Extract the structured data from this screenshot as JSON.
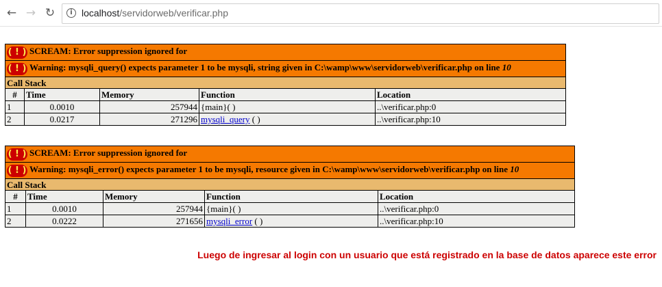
{
  "browser": {
    "back_icon": "arrow-left",
    "forward_icon": "arrow-right",
    "reload_icon": "reload",
    "info_icon": "info",
    "url_host": "localhost",
    "url_path": "/servidorweb/verificar.php"
  },
  "errors": [
    {
      "scream": "SCREAM: Error suppression ignored for",
      "warning_text": "Warning: mysqli_query() expects parameter 1 to be mysqli, string given in C:\\wamp\\www\\servidorweb\\verificar.php on line",
      "line": "10",
      "call_stack_title": "Call Stack",
      "columns": [
        "#",
        "Time",
        "Memory",
        "Function",
        "Location"
      ],
      "rows": [
        {
          "num": "1",
          "time": "0.0010",
          "memory": "257944",
          "func": "{main}",
          "func_suffix": "( )",
          "location": "..\\verificar.php:0"
        },
        {
          "num": "2",
          "time": "0.0217",
          "memory": "271296",
          "func": "mysqli_query",
          "func_suffix": "( )",
          "location": "..\\verificar.php:10"
        }
      ]
    },
    {
      "scream": "SCREAM: Error suppression ignored for",
      "warning_text": "Warning: mysqli_error() expects parameter 1 to be mysqli, resource given in C:\\wamp\\www\\servidorweb\\verificar.php on line",
      "line": "10",
      "call_stack_title": "Call Stack",
      "columns": [
        "#",
        "Time",
        "Memory",
        "Function",
        "Location"
      ],
      "rows": [
        {
          "num": "1",
          "time": "0.0010",
          "memory": "257944",
          "func": "{main}",
          "func_suffix": "( )",
          "location": "..\\verificar.php:0"
        },
        {
          "num": "2",
          "time": "0.0222",
          "memory": "271656",
          "func": "mysqli_error",
          "func_suffix": "( )",
          "location": "..\\verificar.php:10"
        }
      ]
    }
  ],
  "error_icon_text": "( ! )",
  "colors": {
    "warning_bg": "#f57900",
    "stack_title_bg": "#e9b96e",
    "row_bg": "#eeeeec",
    "icon_bg": "#cc0000",
    "note": "#cc0000"
  },
  "note": "Luego de ingresar al login con un usuario que está registrado en la base de datos aparece este error"
}
